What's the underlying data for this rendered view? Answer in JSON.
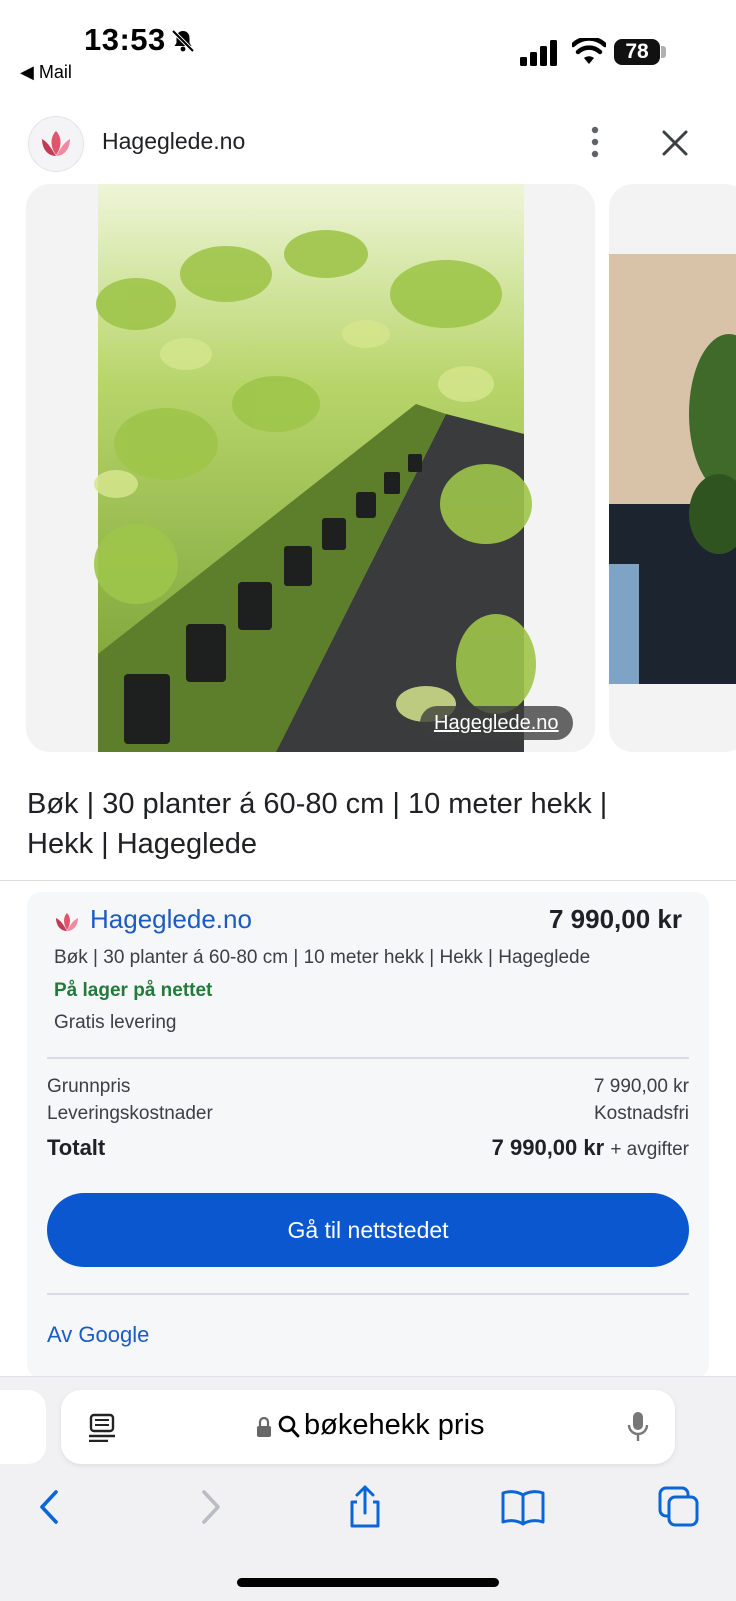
{
  "status_bar": {
    "time": "13:53",
    "back_app": "◀ Mail",
    "battery": "78"
  },
  "header": {
    "site_name": "Hageglede.no",
    "icons": [
      "lotus-logo-icon",
      "more-vert-icon",
      "close-icon"
    ]
  },
  "images": {
    "photo_credit": "Hageglede.no"
  },
  "product": {
    "title": "Bøk | 30 planter á 60-80 cm | 10 meter hekk | Hekk | Hageglede"
  },
  "offer": {
    "merchant": "Hageglede.no",
    "price": "7 990,00 kr",
    "offer_title": "Bøk | 30 planter á 60-80 cm | 10 meter hekk | Hekk | Hageglede",
    "stock": "På lager på nettet",
    "delivery": "Gratis levering",
    "rows": [
      {
        "label": "Grunnpris",
        "value": "7 990,00 kr"
      },
      {
        "label": "Leveringskostnader",
        "value": "Kostnadsfri"
      }
    ],
    "total_label": "Totalt",
    "total_value": "7 990,00 kr",
    "total_suffix": "+ avgifter",
    "cta_label": "Gå til nettstedet",
    "by_google": "Av Google"
  },
  "browser": {
    "url_text": "bøkehekk pris",
    "icons": [
      "reader-icon",
      "lock-icon",
      "search-icon",
      "mic-icon",
      "back-icon",
      "forward-icon",
      "share-icon",
      "bookmarks-icon",
      "tabs-icon"
    ]
  },
  "colors": {
    "accent": "#0b57d0",
    "link": "#1a5bc4",
    "stock_green": "#237a3a",
    "logo_pink": "#e0556e"
  }
}
